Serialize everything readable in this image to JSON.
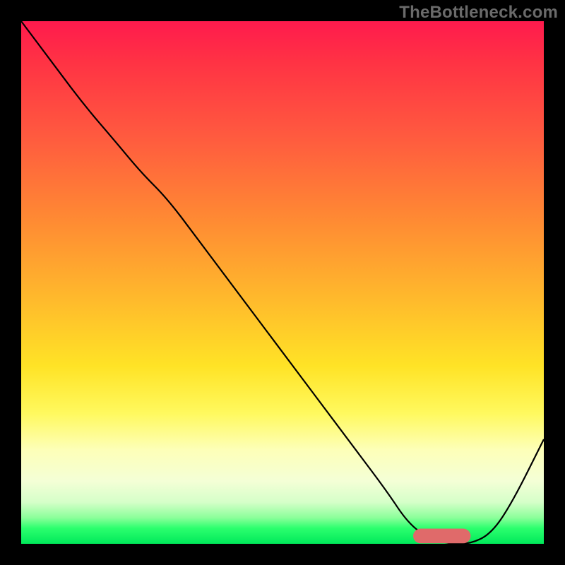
{
  "watermark": "TheBottleneck.com",
  "chart_data": {
    "type": "line",
    "title": "",
    "xlabel": "",
    "ylabel": "",
    "xlim": [
      0,
      100
    ],
    "ylim": [
      0,
      100
    ],
    "grid": false,
    "legend": false,
    "background_gradient": {
      "direction": "vertical",
      "stops": [
        {
          "pos": 0.0,
          "color": "#ff1a4d"
        },
        {
          "pos": 0.08,
          "color": "#ff3344"
        },
        {
          "pos": 0.22,
          "color": "#ff5a3f"
        },
        {
          "pos": 0.38,
          "color": "#ff8a33"
        },
        {
          "pos": 0.53,
          "color": "#ffb92c"
        },
        {
          "pos": 0.66,
          "color": "#ffe326"
        },
        {
          "pos": 0.75,
          "color": "#fff95e"
        },
        {
          "pos": 0.82,
          "color": "#fdffb8"
        },
        {
          "pos": 0.88,
          "color": "#f4ffd6"
        },
        {
          "pos": 0.92,
          "color": "#d6ffc9"
        },
        {
          "pos": 0.95,
          "color": "#8bff9a"
        },
        {
          "pos": 0.97,
          "color": "#2cff6e"
        },
        {
          "pos": 1.0,
          "color": "#00e85a"
        }
      ]
    },
    "series": [
      {
        "name": "bottleneck-curve",
        "color": "#000000",
        "x": [
          0,
          6,
          12,
          18,
          23,
          28,
          34,
          40,
          46,
          52,
          58,
          64,
          70,
          74,
          78,
          82,
          86,
          90,
          94,
          100
        ],
        "y": [
          100,
          92,
          84,
          77,
          71,
          66,
          58,
          50,
          42,
          34,
          26,
          18,
          10,
          4,
          1,
          0,
          0,
          2,
          8,
          20
        ]
      }
    ],
    "marker": {
      "name": "optimal-range",
      "shape": "rounded-bar",
      "color": "#e06a6a",
      "x_start": 75,
      "x_end": 86,
      "y": 1.5,
      "thickness": 2.8
    }
  }
}
